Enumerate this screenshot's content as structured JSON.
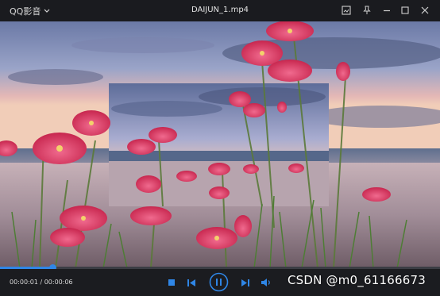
{
  "titlebar": {
    "app_name": "QQ影音",
    "file_name": "DAIJUN_1.mp4",
    "buttons": [
      "screenshot-icon",
      "pin-icon",
      "minimize-icon",
      "maximize-icon",
      "close-icon"
    ]
  },
  "player": {
    "current_time": "00:00:01",
    "separator": " / ",
    "total_time": "00:00:06",
    "progress": 0.12,
    "controls": [
      "stop-icon",
      "previous-icon",
      "pause-icon",
      "next-icon",
      "volume-icon"
    ]
  },
  "colors": {
    "accent": "#2f86e6",
    "titlebar": "#1a1b1f",
    "controlbar": "#1b1c20"
  },
  "watermark": "CSDN @m0_61166673"
}
